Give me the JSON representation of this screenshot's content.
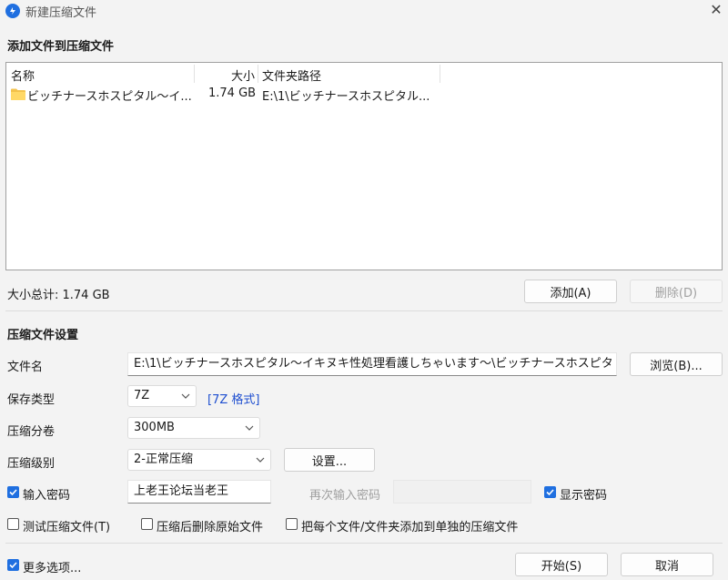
{
  "window": {
    "title": "新建压缩文件",
    "close": "✕"
  },
  "add_section": {
    "title": "添加文件到压缩文件",
    "columns": [
      "名称",
      "大小",
      "文件夹路径"
    ],
    "rows": [
      {
        "name": "ビッチナースホスピタル～イ...",
        "size": "1.74 GB",
        "path": "E:\\1\\ビッチナースホスピタル..."
      }
    ],
    "total_label": "大小总计: 1.74 GB",
    "add_button": "添加(A)",
    "delete_button": "删除(D)"
  },
  "settings": {
    "title": "压缩文件设置",
    "filename_label": "文件名",
    "filename_value": "E:\\1\\ビッチナースホスピタル～イキヌキ性処理看護しちゃいます～\\ビッチナースホスピタ",
    "browse_button": "浏览(B)...",
    "save_type_label": "保存类型",
    "save_type_value": "7Z",
    "format_link": "[7Z 格式]",
    "split_label": "压缩分卷",
    "split_value": "300MB",
    "level_label": "压缩级别",
    "level_value": "2-正常压缩",
    "level_settings_button": "设置...",
    "password_label": "输入密码",
    "password_checked": true,
    "password_value": "上老王论坛当老王",
    "password_confirm_placeholder": "再次输入密码",
    "show_password_label": "显示密码",
    "show_password_checked": true,
    "test_label": "测试压缩文件(T)",
    "test_checked": false,
    "delete_after_label": "压缩后删除原始文件",
    "delete_after_checked": false,
    "separate_label": "把每个文件/文件夹添加到单独的压缩文件",
    "separate_checked": false
  },
  "footer": {
    "more_options_label": "更多选项...",
    "more_options_checked": true,
    "start_button": "开始(S)",
    "cancel_button": "取消"
  },
  "colors": {
    "accent": "#1f6fe0",
    "link": "#1f4fd0",
    "background": "#f3f3f3"
  }
}
